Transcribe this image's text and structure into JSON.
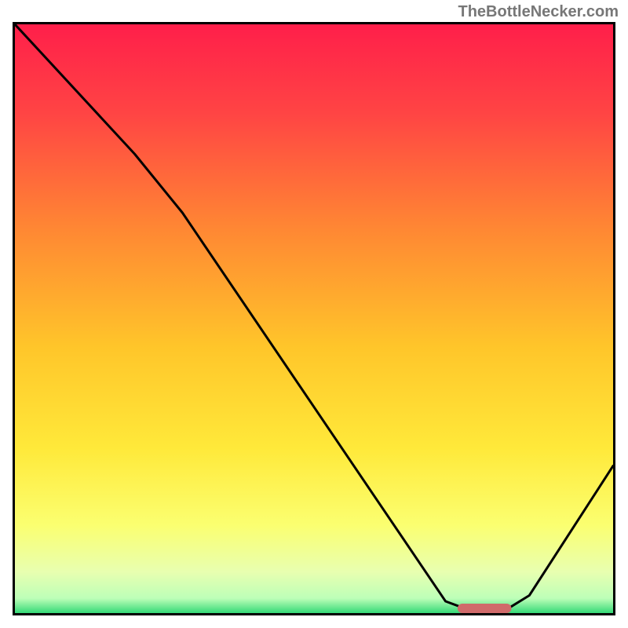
{
  "watermark": "TheBottleNecker.com",
  "chart_data": {
    "type": "line",
    "title": "",
    "xlabel": "",
    "ylabel": "",
    "xlim": [
      0,
      100
    ],
    "ylim": [
      0,
      100
    ],
    "curve": [
      {
        "x": 0,
        "y": 100
      },
      {
        "x": 20,
        "y": 78
      },
      {
        "x": 28,
        "y": 68
      },
      {
        "x": 72,
        "y": 2
      },
      {
        "x": 76,
        "y": 0.5
      },
      {
        "x": 82,
        "y": 0.5
      },
      {
        "x": 86,
        "y": 3
      },
      {
        "x": 100,
        "y": 25
      }
    ],
    "marker": {
      "x_start": 74,
      "x_end": 83,
      "y": 0.8,
      "color": "#d06a6a"
    },
    "gradient_stops": [
      {
        "offset": 0,
        "color": "#ff1f4a"
      },
      {
        "offset": 0.15,
        "color": "#ff4444"
      },
      {
        "offset": 0.35,
        "color": "#ff8833"
      },
      {
        "offset": 0.55,
        "color": "#ffc62a"
      },
      {
        "offset": 0.72,
        "color": "#ffe93a"
      },
      {
        "offset": 0.85,
        "color": "#fbff70"
      },
      {
        "offset": 0.93,
        "color": "#e8ffb0"
      },
      {
        "offset": 0.975,
        "color": "#bdffb8"
      },
      {
        "offset": 1,
        "color": "#35d977"
      }
    ]
  }
}
